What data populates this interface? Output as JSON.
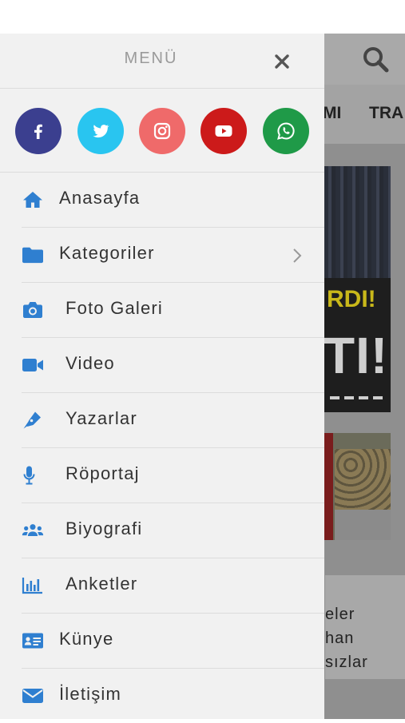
{
  "drawer": {
    "title": "MENÜ",
    "close_icon": "close-icon",
    "socials": [
      {
        "name": "facebook",
        "icon": "facebook-icon",
        "color": "#3b3f8f"
      },
      {
        "name": "twitter",
        "icon": "twitter-icon",
        "color": "#29c5f0"
      },
      {
        "name": "instagram",
        "icon": "instagram-icon",
        "color": "#ef6a6a"
      },
      {
        "name": "youtube",
        "icon": "youtube-icon",
        "color": "#cc1a1a"
      },
      {
        "name": "whatsapp",
        "icon": "whatsapp-icon",
        "color": "#1f9a48"
      }
    ],
    "items": [
      {
        "label": "Anasayfa",
        "icon": "home-icon"
      },
      {
        "label": "Kategoriler",
        "icon": "folder-icon",
        "has_submenu": true
      },
      {
        "label": "Foto Galeri",
        "icon": "camera-icon"
      },
      {
        "label": "Video",
        "icon": "video-icon"
      },
      {
        "label": "Yazarlar",
        "icon": "pen-icon"
      },
      {
        "label": "Röportaj",
        "icon": "microphone-icon"
      },
      {
        "label": "Biyografi",
        "icon": "users-icon"
      },
      {
        "label": "Anketler",
        "icon": "chart-icon"
      },
      {
        "label": "Künye",
        "icon": "id-card-icon"
      },
      {
        "label": "İletişim",
        "icon": "envelope-icon"
      }
    ],
    "accent_color": "#2f7fd0"
  },
  "background_page": {
    "nav_items": [
      "MI",
      "TRA"
    ],
    "card_texts": [
      "RDI!",
      "TI!"
    ],
    "article_lines": [
      "eler",
      "han",
      "sızlar"
    ]
  }
}
